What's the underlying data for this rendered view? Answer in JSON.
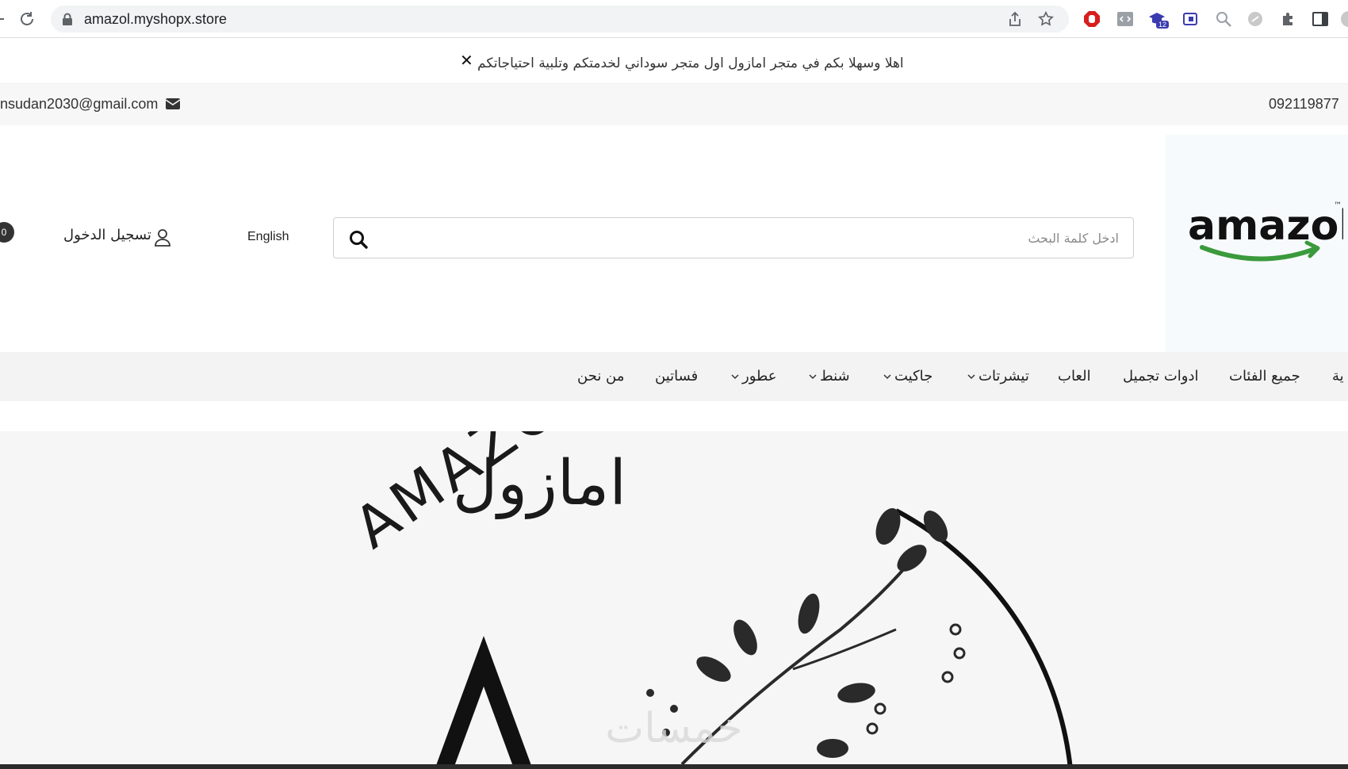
{
  "browser": {
    "url": "amazol.myshopx.store",
    "extension_badge": "12"
  },
  "announcement": {
    "text": "اهلا وسهلا بكم في متجر امازول اول متجر سوداني لخدمتكم وتلبية احتياجاتكم",
    "close_label": "✕"
  },
  "contact": {
    "email": "nsudan2030@gmail.com",
    "phone": "092119877"
  },
  "header": {
    "cart_count": "0",
    "login_label": "تسجيل الدخول",
    "language_label": "English",
    "search_placeholder": "ادخل كلمة البحث",
    "logo_text": "amazol",
    "logo_tm": "™"
  },
  "nav": {
    "items": [
      {
        "label": "ية"
      },
      {
        "label": "جميع الفئات"
      },
      {
        "label": "ادوات تجميل"
      },
      {
        "label": "العاب"
      },
      {
        "label": "تيشرتات"
      },
      {
        "label": "جاكيت"
      },
      {
        "label": "شنط"
      },
      {
        "label": "عطور"
      },
      {
        "label": "فساتين"
      },
      {
        "label": "من نحن"
      }
    ]
  },
  "hero": {
    "arabic_brand": "امازول",
    "latin_brand": "AMAZOL",
    "monogram": "A",
    "watermark": "خمسات"
  },
  "colors": {
    "logo_green": "#3a9a3c",
    "accent_dark": "#222222"
  }
}
